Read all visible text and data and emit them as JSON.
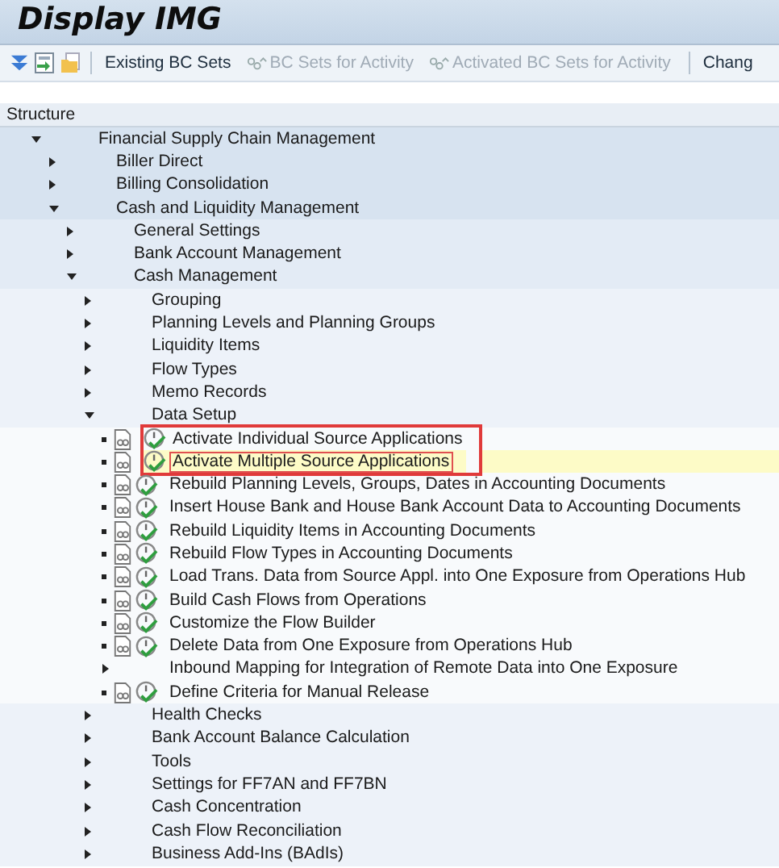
{
  "window": {
    "title": "Display IMG"
  },
  "toolbar": [
    {
      "kind": "icon"
    },
    {
      "kind": "icon"
    },
    {
      "kind": "icon"
    },
    {
      "kind": "separator"
    },
    {
      "kind": "button",
      "label": "Existing BC Sets",
      "disabled": false
    },
    {
      "kind": "set-button",
      "label": "BC Sets for Activity",
      "disabled": true
    },
    {
      "kind": "set-button",
      "label": "Activated BC Sets for Activity",
      "disabled": true
    },
    {
      "kind": "separator"
    },
    {
      "kind": "button",
      "label": "Chang",
      "disabled": false
    }
  ],
  "tree": {
    "header": "Structure",
    "items": [
      {
        "kind": "folder",
        "label": "Financial Supply Chain Management",
        "expanded": true,
        "children": [
          {
            "kind": "folder",
            "label": "Biller Direct",
            "expanded": false
          },
          {
            "kind": "folder",
            "label": "Billing Consolidation",
            "expanded": false
          },
          {
            "kind": "folder",
            "label": "Cash and Liquidity Management",
            "expanded": true,
            "children": [
              {
                "kind": "folder",
                "label": "General Settings",
                "expanded": false
              },
              {
                "kind": "folder",
                "label": "Bank Account Management",
                "expanded": false
              },
              {
                "kind": "folder",
                "label": "Cash Management",
                "expanded": true,
                "children": [
                  {
                    "kind": "folder",
                    "label": "Grouping",
                    "expanded": false
                  },
                  {
                    "kind": "folder",
                    "label": "Planning Levels and Planning Groups",
                    "expanded": false
                  },
                  {
                    "kind": "folder",
                    "label": "Liquidity Items",
                    "expanded": false
                  },
                  {
                    "kind": "folder",
                    "label": "Flow Types",
                    "expanded": false
                  },
                  {
                    "kind": "folder",
                    "label": "Memo Records",
                    "expanded": false
                  },
                  {
                    "kind": "folder",
                    "label": "Data Setup",
                    "expanded": true,
                    "children": [
                      {
                        "kind": "activity",
                        "label": "Activate Individual Source Applications",
                        "selected": false,
                        "marked": true
                      },
                      {
                        "kind": "activity",
                        "label": "Activate Multiple Source Applications",
                        "selected": true,
                        "marked": true
                      },
                      {
                        "kind": "activity",
                        "label": "Rebuild Planning Levels, Groups, Dates in Accounting Documents",
                        "selected": false,
                        "marked": false
                      },
                      {
                        "kind": "activity",
                        "label": "Insert House Bank and House Bank Account Data to Accounting Documents",
                        "selected": false,
                        "marked": false
                      },
                      {
                        "kind": "activity",
                        "label": "Rebuild Liquidity Items in Accounting Documents",
                        "selected": false,
                        "marked": false
                      },
                      {
                        "kind": "activity",
                        "label": "Rebuild Flow Types in Accounting Documents",
                        "selected": false,
                        "marked": false
                      },
                      {
                        "kind": "activity",
                        "label": "Load Trans. Data from Source Appl. into One Exposure from Operations Hub",
                        "selected": false,
                        "marked": false
                      },
                      {
                        "kind": "activity",
                        "label": "Build Cash Flows from Operations",
                        "selected": false,
                        "marked": false
                      },
                      {
                        "kind": "activity",
                        "label": "Customize the Flow Builder",
                        "selected": false,
                        "marked": false
                      },
                      {
                        "kind": "activity",
                        "label": "Delete Data from One Exposure from Operations Hub",
                        "selected": false,
                        "marked": false
                      },
                      {
                        "kind": "folder",
                        "label": "Inbound Mapping for Integration of Remote Data into One Exposure",
                        "expanded": false
                      },
                      {
                        "kind": "activity",
                        "label": "Define Criteria for Manual Release",
                        "selected": false,
                        "marked": false
                      }
                    ]
                  },
                  {
                    "kind": "folder",
                    "label": "Health Checks",
                    "expanded": false
                  },
                  {
                    "kind": "folder",
                    "label": "Bank Account Balance Calculation",
                    "expanded": false
                  },
                  {
                    "kind": "folder",
                    "label": "Tools",
                    "expanded": false
                  },
                  {
                    "kind": "folder",
                    "label": "Settings for FF7AN and FF7BN",
                    "expanded": false
                  },
                  {
                    "kind": "folder",
                    "label": "Cash Concentration",
                    "expanded": false
                  },
                  {
                    "kind": "folder",
                    "label": "Cash Flow Reconciliation",
                    "expanded": false
                  },
                  {
                    "kind": "folder",
                    "label": "Business Add-Ins (BAdIs)",
                    "expanded": false
                  }
                ]
              }
            ]
          }
        ]
      }
    ]
  }
}
